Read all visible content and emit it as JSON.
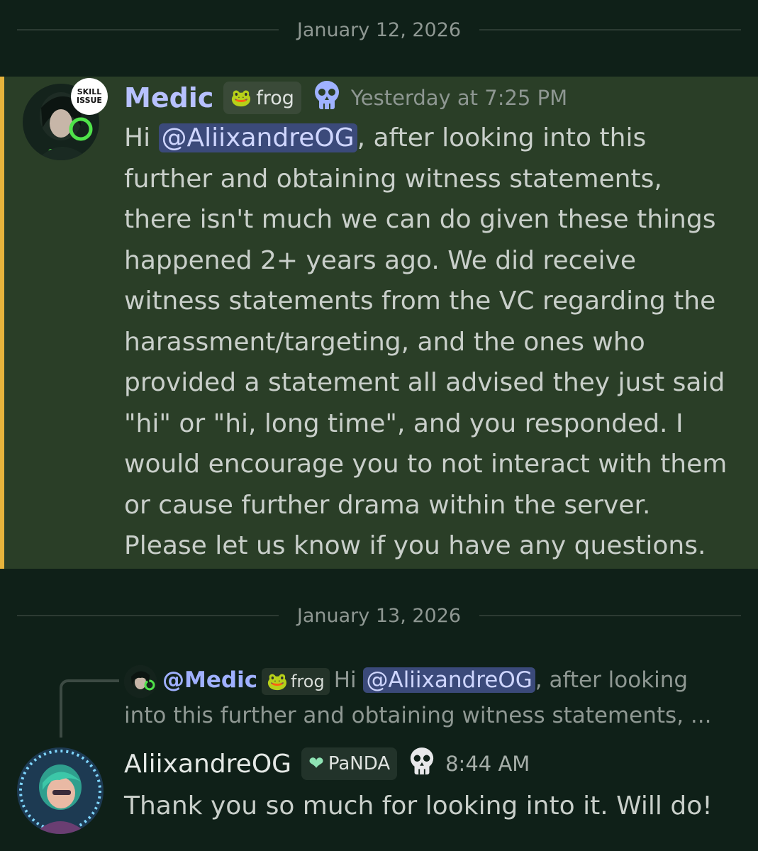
{
  "dates": {
    "first": "January 12, 2026",
    "second": "January 13, 2026"
  },
  "message1": {
    "author": "Medic",
    "tag": "frog",
    "badge_text": "SKILL ISSUE",
    "timestamp": "Yesterday at 7:25 PM",
    "greeting": "Hi",
    "mention": "@AliixandreOG",
    "lines": [
      ", after looking into this",
      "further and obtaining witness statements,",
      "there isn't much we can do given these things",
      "happened 2+ years ago.  We did receive",
      "witness statements from the VC regarding the",
      "harassment/targeting, and the ones who",
      "provided a statement all advised they just said",
      "\"hi\" or \"hi, long time\", and you responded.  I",
      "would encourage you to not interact with them",
      "or cause further drama within the server.",
      "Please let us know if you have any questions."
    ],
    "highlight_color": "#e6b33c"
  },
  "reply": {
    "author": "@Medic",
    "tag": "frog",
    "greeting": "Hi",
    "mention": "@AliixandreOG",
    "text_line1": ", after looking",
    "text_line2": "into this further and obtaining witness statements, ..."
  },
  "message2": {
    "author": "AliixandreOG",
    "tag": "PaNDA",
    "timestamp": "8:44 AM",
    "text": "Thank you so much for looking into it. Will do!"
  }
}
